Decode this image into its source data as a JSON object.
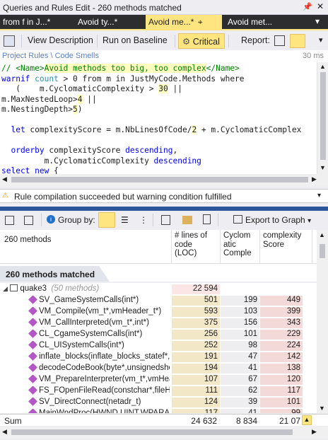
{
  "window": {
    "title": "Queries and Rules Edit  - 260 methods matched"
  },
  "tabs": [
    "from f in J...*",
    "Avoid ty...*",
    "Avoid me...*",
    "Avoid met..."
  ],
  "toolbar": {
    "view_description": "View Description",
    "run_on_baseline": "Run on Baseline",
    "critical": "Critical",
    "report": "Report:"
  },
  "breadcrumb": {
    "path": "Project Rules \\ Code Smells",
    "time": "30 ms"
  },
  "code": {
    "l1_a": "// <Name>",
    "l1_b": "Avoid methods too big, too complex",
    "l1_c": "</Name>",
    "l2_a": "warnif",
    "l2_b": " count ",
    "l2_c": "> 0 from m in JustMyCode.Methods where",
    "l3": "   (    m.CyclomaticComplexity > ",
    "l3_num": "30",
    "l3_end": " ||",
    "l4_a": "m.MaxNestedLoop>",
    "l4_num": "4",
    "l4_end": " ||",
    "l5_a": "m.NestingDepth>",
    "l5_num": "5",
    "l5_end": ")",
    "l6_a": "  let",
    "l6_b": " complexityScore = m.NbLinesOfCode/",
    "l6_num": "2",
    "l6_c": " + m.CyclomaticComplex",
    "l7_a": "  orderby",
    "l7_b": " complexityScore ",
    "l7_c": "descending",
    "l7_d": ",",
    "l8_a": "         m.CyclomaticComplexity ",
    "l8_b": "descending",
    "l9_a": "select new",
    "l9_b": " {"
  },
  "status": {
    "warning": "Rule compilation succeeded but warning condition fulfilled"
  },
  "results_toolbar": {
    "group_by": "Group by:",
    "export": "Export to Graph"
  },
  "grid": {
    "title": "260 methods",
    "col_loc": "# lines of\ncode\n(LOC)",
    "col_cc": "Cyclom\natic\nComple",
    "col_score": "complexity\nScore",
    "group_label": "260 methods matched",
    "assembly": {
      "name": "quake3",
      "count": "(50 methods)",
      "loc": "22 594"
    },
    "rows": [
      {
        "name": "SV_GameSystemCalls(int*)",
        "loc": "501",
        "cc": "199",
        "score": "449"
      },
      {
        "name": "VM_Compile(vm_t*,vmHeader_t*)",
        "loc": "593",
        "cc": "103",
        "score": "399"
      },
      {
        "name": "VM_CallInterpreted(vm_t*,int*)",
        "loc": "375",
        "cc": "156",
        "score": "343"
      },
      {
        "name": "CL_CgameSystemCalls(int*)",
        "loc": "256",
        "cc": "101",
        "score": "229"
      },
      {
        "name": "CL_UISystemCalls(int*)",
        "loc": "252",
        "cc": "98",
        "score": "224"
      },
      {
        "name": "inflate_blocks(inflate_blocks_statef*,z",
        "loc": "191",
        "cc": "47",
        "score": "142"
      },
      {
        "name": "decodeCodeBook(byte*,unsignedshor",
        "loc": "194",
        "cc": "41",
        "score": "138"
      },
      {
        "name": "VM_PrepareInterpreter(vm_t*,vmHeac",
        "loc": "107",
        "cc": "67",
        "score": "120"
      },
      {
        "name": "FS_FOpenFileRead(constchar*,fileHa",
        "loc": "111",
        "cc": "62",
        "score": "117"
      },
      {
        "name": "SV_DirectConnect(netadr_t)",
        "loc": "124",
        "cc": "39",
        "score": "101"
      },
      {
        "name": "MainWndProc(HWND,UINT,WPARAM",
        "loc": "117",
        "cc": "41",
        "score": "99"
      }
    ],
    "sum": {
      "label": "Sum",
      "loc": "24 632",
      "cc": "8 834",
      "score": "21 07"
    }
  },
  "colors": {
    "accent": "#ffe580",
    "tabbar": "#2d2d30",
    "splitter": "#2b579a",
    "method_icon": "#b455c8"
  }
}
